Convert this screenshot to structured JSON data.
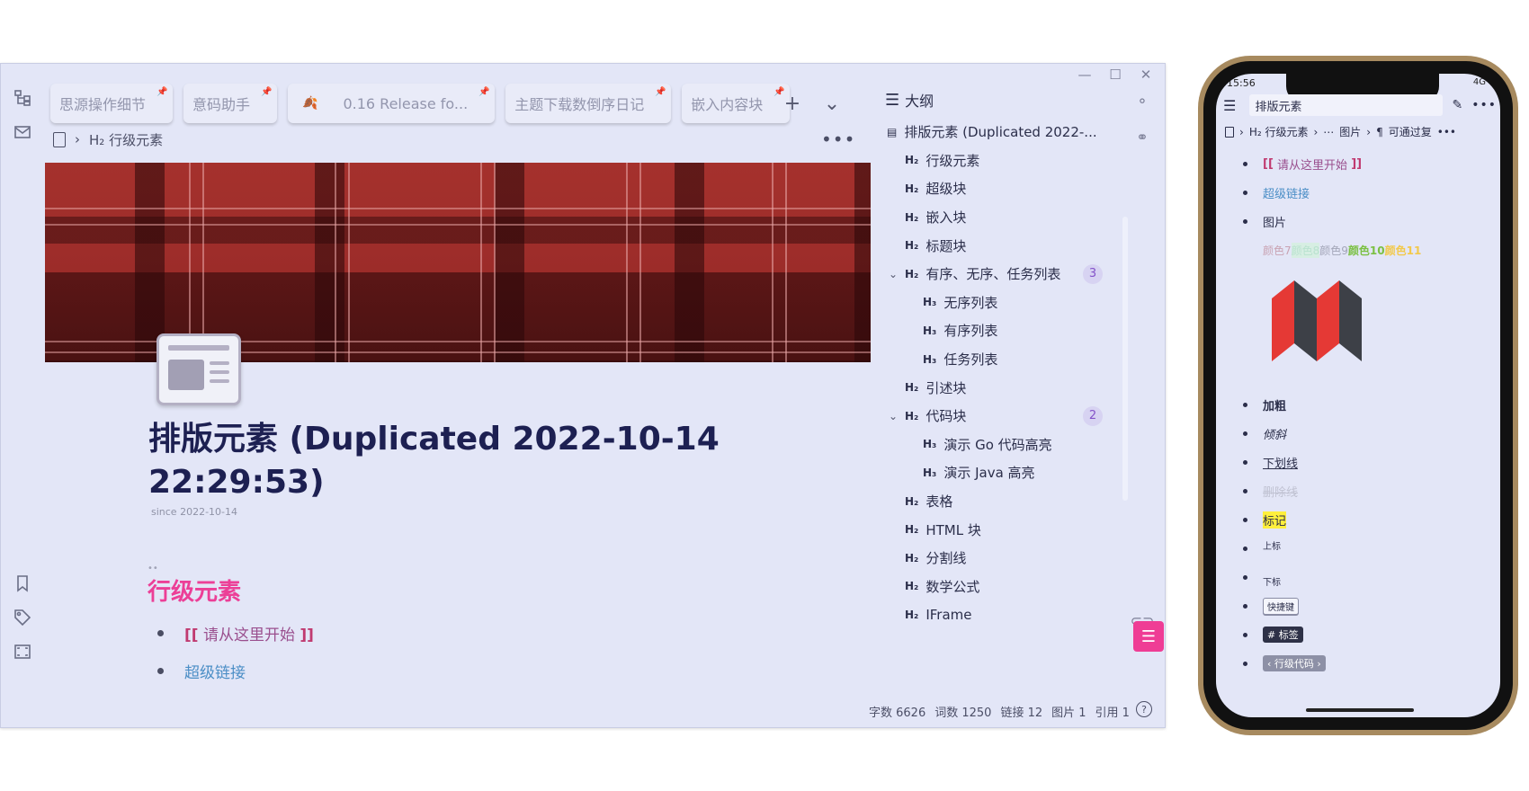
{
  "tabs": [
    {
      "label": "思源操作细节"
    },
    {
      "label": "意码助手"
    },
    {
      "label": "0.16 Release fo..."
    },
    {
      "label": "主题下载数倒序日记"
    },
    {
      "label": "嵌入内容块"
    }
  ],
  "breadcrumb": {
    "heading_tag": "H₂",
    "label": "行级元素"
  },
  "document": {
    "title": "排版元素 (Duplicated 2022-10-14 22:29:53)",
    "since": "since 2022-10-14",
    "h2": "行级元素",
    "list": [
      {
        "open": "[[",
        "text": "请从这里开始",
        "close": "]]"
      },
      {
        "text": "超级链接"
      }
    ]
  },
  "outline": {
    "title": "大纲",
    "items": [
      {
        "tag": "",
        "label": "排版元素 (Duplicated 2022-...",
        "level": 1
      },
      {
        "tag": "H₂",
        "label": "行级元素",
        "level": 2
      },
      {
        "tag": "H₂",
        "label": "超级块",
        "level": 2
      },
      {
        "tag": "H₂",
        "label": "嵌入块",
        "level": 2
      },
      {
        "tag": "H₂",
        "label": "标题块",
        "level": 2
      },
      {
        "tag": "H₂",
        "label": "有序、无序、任务列表",
        "level": 2,
        "count": "3",
        "expanded": true
      },
      {
        "tag": "H₃",
        "label": "无序列表",
        "level": 3
      },
      {
        "tag": "H₃",
        "label": "有序列表",
        "level": 3
      },
      {
        "tag": "H₃",
        "label": "任务列表",
        "level": 3
      },
      {
        "tag": "H₂",
        "label": "引述块",
        "level": 2
      },
      {
        "tag": "H₂",
        "label": "代码块",
        "level": 2,
        "count": "2",
        "expanded": true
      },
      {
        "tag": "H₃",
        "label": "演示 Go 代码高亮",
        "level": 3
      },
      {
        "tag": "H₃",
        "label": "演示 Java 高亮",
        "level": 3
      },
      {
        "tag": "H₂",
        "label": "表格",
        "level": 2
      },
      {
        "tag": "H₂",
        "label": "HTML 块",
        "level": 2
      },
      {
        "tag": "H₂",
        "label": "分割线",
        "level": 2
      },
      {
        "tag": "H₂",
        "label": "数学公式",
        "level": 2
      },
      {
        "tag": "H₂",
        "label": "IFrame",
        "level": 2
      }
    ]
  },
  "status": {
    "words": "字数 6626",
    "terms": "词数 1250",
    "links": "链接 12",
    "images": "图片 1",
    "refs": "引用 1"
  },
  "phone": {
    "time": "15:56",
    "signal": "4G",
    "title": "排版元素",
    "crumb": {
      "h2": "H₂ 行级元素",
      "img": "图片",
      "para": "可通过复"
    },
    "list": {
      "ref_open": "[[",
      "ref_text": "请从这里开始",
      "ref_close": "]]",
      "link": "超级链接",
      "image": "图片",
      "colors": [
        "颜色7",
        "颜色8",
        "颜色9",
        "颜色10",
        "颜色11"
      ],
      "bold": "加粗",
      "italic": "倾斜",
      "underline": "下划线",
      "strike": "删除线",
      "mark": "标记",
      "sup": "上标",
      "sub": "下标",
      "kbd": "快捷键",
      "tag": "标签",
      "code": "行级代码"
    }
  },
  "colors": {
    "accent": "#ef3d95",
    "title": "#1d2052",
    "link": "#4b8ec6",
    "banner": "#a5312d"
  }
}
